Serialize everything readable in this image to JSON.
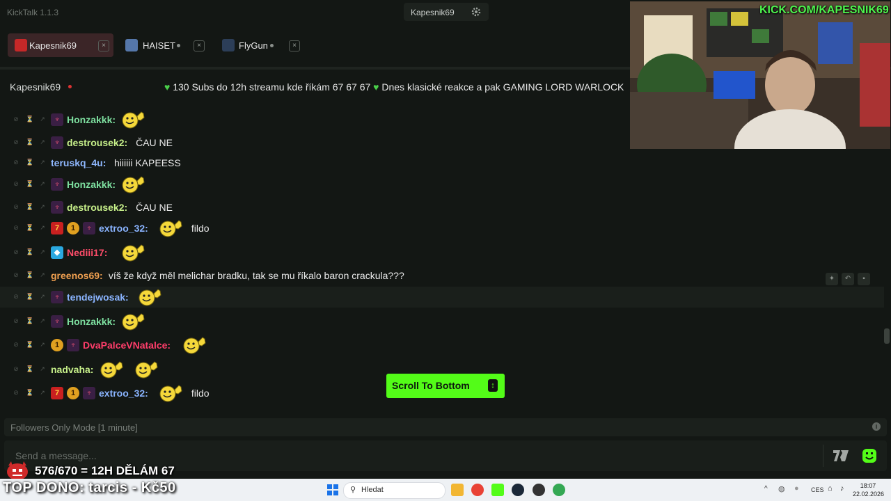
{
  "app": {
    "title": "KickTalk 1.1.3"
  },
  "header": {
    "user_menu_label": "Kapesnik69"
  },
  "tabs": [
    {
      "label": "Kapesnik69",
      "close": "×"
    },
    {
      "label": "HAISET",
      "close": "×"
    },
    {
      "label": "FlyGun",
      "close": "×"
    }
  ],
  "channel": {
    "name": "Kapesnik69",
    "marquee": "130 Subs do 12h streamu kde říkám 67 67 67",
    "marquee2": "Dnes klasické reakce a pak GAMING LORD WARLOCK"
  },
  "messages": [
    {
      "user": "Honzakkk",
      "text": "",
      "badges": [
        "sub"
      ],
      "emotes": 1
    },
    {
      "user": "destrousek2",
      "text": "ČAU NE",
      "badges": [
        "sub"
      ],
      "emotes": 0
    },
    {
      "user": "teruskq_4u",
      "text": "hiiiiii KAPEESS",
      "badges": [],
      "emotes": 0
    },
    {
      "user": "Honzakkk",
      "text": "",
      "badges": [
        "sub"
      ],
      "emotes": 1
    },
    {
      "user": "destrousek2",
      "text": "ČAU NE",
      "badges": [
        "sub"
      ],
      "emotes": 0
    },
    {
      "user": "extroo_32",
      "text": "fildo",
      "badges": [
        "red",
        "gold",
        "sub"
      ],
      "emotes": 1
    },
    {
      "user": "Nediii17",
      "text": "",
      "badges": [
        "blue"
      ],
      "emotes": 1
    },
    {
      "user": "greenos69",
      "text": "víš že když měl melichar bradku, tak se mu říkalo baron crackula???",
      "badges": [],
      "emotes": 0
    },
    {
      "user": "tendejwosak",
      "text": "",
      "badges": [
        "sub"
      ],
      "emotes": 1
    },
    {
      "user": "Honzakkk",
      "text": "",
      "badges": [
        "sub"
      ],
      "emotes": 1
    },
    {
      "user": "DvaPalceVNatalce",
      "text": "",
      "badges": [
        "gold",
        "sub"
      ],
      "emotes": 1
    },
    {
      "user": "nadvaha",
      "text": "",
      "badges": [],
      "emotes": 2
    },
    {
      "user": "extroo_32",
      "text": "fildo",
      "badges": [
        "red",
        "gold",
        "sub"
      ],
      "emotes": 1
    }
  ],
  "scroll_to_bottom": {
    "label": "Scroll To Bottom"
  },
  "chat_mode": {
    "label": "Followers Only Mode [1 minute]"
  },
  "input": {
    "placeholder": "Send a message..."
  },
  "overlay": {
    "goal": "576/670 = 12H DĚLÁM 67",
    "top_dono": "TOP DONO: tarcis - Kč50",
    "webcam_url": "KICK.COM/KAPESNIK69"
  },
  "taskbar": {
    "search_label": "Hledat",
    "lang": "CES",
    "time": "18:07",
    "date": "22.02.2026"
  },
  "colors": {
    "kick_green": "#53fc18",
    "background": "#131714"
  }
}
